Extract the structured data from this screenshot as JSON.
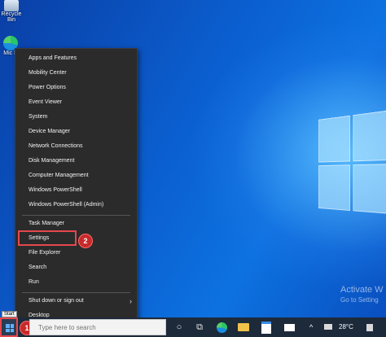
{
  "desktop": {
    "recycle_label": "Recycle Bin",
    "edge_label": "Mic E",
    "watermark_title": "Activate W",
    "watermark_sub": "Go to Setting"
  },
  "winx_menu": {
    "items": [
      "Apps and Features",
      "Mobility Center",
      "Power Options",
      "Event Viewer",
      "System",
      "Device Manager",
      "Network Connections",
      "Disk Management",
      "Computer Management",
      "Windows PowerShell",
      "Windows PowerShell (Admin)",
      "Task Manager",
      "Settings",
      "File Explorer",
      "Search",
      "Run",
      "Shut down or sign out",
      "Desktop"
    ]
  },
  "annotations": {
    "step1": "1",
    "step2": "2",
    "highlight_color": "#e5484d"
  },
  "start_tooltip": "Start",
  "taskbar": {
    "search_placeholder": "Type here to search",
    "temperature": "28°C"
  }
}
